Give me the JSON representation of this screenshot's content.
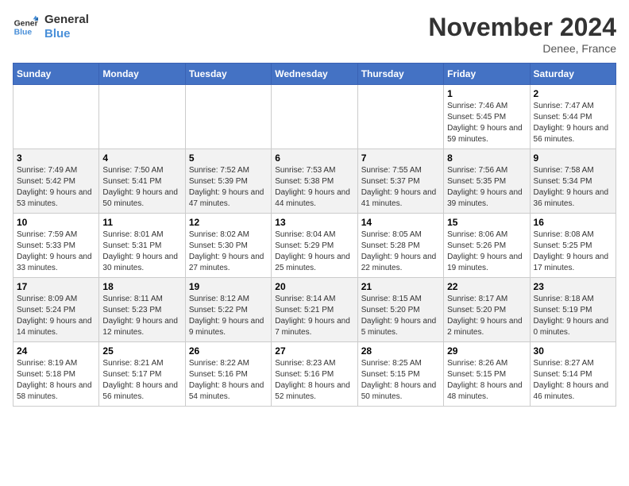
{
  "logo": {
    "line1": "General",
    "line2": "Blue"
  },
  "title": "November 2024",
  "location": "Denee, France",
  "days_of_week": [
    "Sunday",
    "Monday",
    "Tuesday",
    "Wednesday",
    "Thursday",
    "Friday",
    "Saturday"
  ],
  "weeks": [
    [
      {
        "day": "",
        "info": ""
      },
      {
        "day": "",
        "info": ""
      },
      {
        "day": "",
        "info": ""
      },
      {
        "day": "",
        "info": ""
      },
      {
        "day": "",
        "info": ""
      },
      {
        "day": "1",
        "info": "Sunrise: 7:46 AM\nSunset: 5:45 PM\nDaylight: 9 hours and 59 minutes."
      },
      {
        "day": "2",
        "info": "Sunrise: 7:47 AM\nSunset: 5:44 PM\nDaylight: 9 hours and 56 minutes."
      }
    ],
    [
      {
        "day": "3",
        "info": "Sunrise: 7:49 AM\nSunset: 5:42 PM\nDaylight: 9 hours and 53 minutes."
      },
      {
        "day": "4",
        "info": "Sunrise: 7:50 AM\nSunset: 5:41 PM\nDaylight: 9 hours and 50 minutes."
      },
      {
        "day": "5",
        "info": "Sunrise: 7:52 AM\nSunset: 5:39 PM\nDaylight: 9 hours and 47 minutes."
      },
      {
        "day": "6",
        "info": "Sunrise: 7:53 AM\nSunset: 5:38 PM\nDaylight: 9 hours and 44 minutes."
      },
      {
        "day": "7",
        "info": "Sunrise: 7:55 AM\nSunset: 5:37 PM\nDaylight: 9 hours and 41 minutes."
      },
      {
        "day": "8",
        "info": "Sunrise: 7:56 AM\nSunset: 5:35 PM\nDaylight: 9 hours and 39 minutes."
      },
      {
        "day": "9",
        "info": "Sunrise: 7:58 AM\nSunset: 5:34 PM\nDaylight: 9 hours and 36 minutes."
      }
    ],
    [
      {
        "day": "10",
        "info": "Sunrise: 7:59 AM\nSunset: 5:33 PM\nDaylight: 9 hours and 33 minutes."
      },
      {
        "day": "11",
        "info": "Sunrise: 8:01 AM\nSunset: 5:31 PM\nDaylight: 9 hours and 30 minutes."
      },
      {
        "day": "12",
        "info": "Sunrise: 8:02 AM\nSunset: 5:30 PM\nDaylight: 9 hours and 27 minutes."
      },
      {
        "day": "13",
        "info": "Sunrise: 8:04 AM\nSunset: 5:29 PM\nDaylight: 9 hours and 25 minutes."
      },
      {
        "day": "14",
        "info": "Sunrise: 8:05 AM\nSunset: 5:28 PM\nDaylight: 9 hours and 22 minutes."
      },
      {
        "day": "15",
        "info": "Sunrise: 8:06 AM\nSunset: 5:26 PM\nDaylight: 9 hours and 19 minutes."
      },
      {
        "day": "16",
        "info": "Sunrise: 8:08 AM\nSunset: 5:25 PM\nDaylight: 9 hours and 17 minutes."
      }
    ],
    [
      {
        "day": "17",
        "info": "Sunrise: 8:09 AM\nSunset: 5:24 PM\nDaylight: 9 hours and 14 minutes."
      },
      {
        "day": "18",
        "info": "Sunrise: 8:11 AM\nSunset: 5:23 PM\nDaylight: 9 hours and 12 minutes."
      },
      {
        "day": "19",
        "info": "Sunrise: 8:12 AM\nSunset: 5:22 PM\nDaylight: 9 hours and 9 minutes."
      },
      {
        "day": "20",
        "info": "Sunrise: 8:14 AM\nSunset: 5:21 PM\nDaylight: 9 hours and 7 minutes."
      },
      {
        "day": "21",
        "info": "Sunrise: 8:15 AM\nSunset: 5:20 PM\nDaylight: 9 hours and 5 minutes."
      },
      {
        "day": "22",
        "info": "Sunrise: 8:17 AM\nSunset: 5:20 PM\nDaylight: 9 hours and 2 minutes."
      },
      {
        "day": "23",
        "info": "Sunrise: 8:18 AM\nSunset: 5:19 PM\nDaylight: 9 hours and 0 minutes."
      }
    ],
    [
      {
        "day": "24",
        "info": "Sunrise: 8:19 AM\nSunset: 5:18 PM\nDaylight: 8 hours and 58 minutes."
      },
      {
        "day": "25",
        "info": "Sunrise: 8:21 AM\nSunset: 5:17 PM\nDaylight: 8 hours and 56 minutes."
      },
      {
        "day": "26",
        "info": "Sunrise: 8:22 AM\nSunset: 5:16 PM\nDaylight: 8 hours and 54 minutes."
      },
      {
        "day": "27",
        "info": "Sunrise: 8:23 AM\nSunset: 5:16 PM\nDaylight: 8 hours and 52 minutes."
      },
      {
        "day": "28",
        "info": "Sunrise: 8:25 AM\nSunset: 5:15 PM\nDaylight: 8 hours and 50 minutes."
      },
      {
        "day": "29",
        "info": "Sunrise: 8:26 AM\nSunset: 5:15 PM\nDaylight: 8 hours and 48 minutes."
      },
      {
        "day": "30",
        "info": "Sunrise: 8:27 AM\nSunset: 5:14 PM\nDaylight: 8 hours and 46 minutes."
      }
    ]
  ]
}
